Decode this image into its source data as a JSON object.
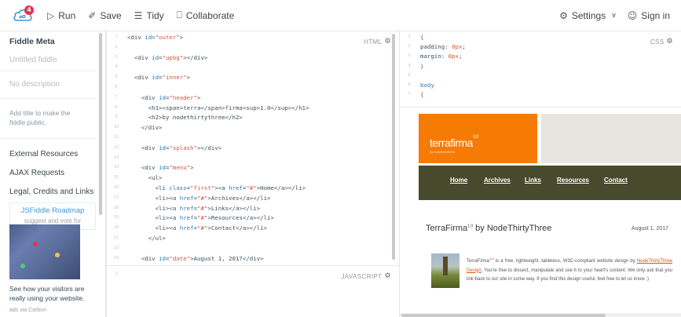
{
  "toolbar": {
    "logo_badge": "4",
    "run_label": "Run",
    "save_label": "Save",
    "tidy_label": "Tidy",
    "collaborate_label": "Collaborate",
    "settings_label": "Settings",
    "signin_label": "Sign in"
  },
  "sidebar": {
    "heading": "Fiddle Meta",
    "title_placeholder": "Untitled fiddle",
    "desc_placeholder": "No description",
    "help_text": "Add title to make the fiddle public.",
    "links": [
      "External Resources",
      "AJAX Requests",
      "Legal, Credits and Links"
    ],
    "roadmap_title": "JSFiddle Roadmap",
    "roadmap_sub": "suggest and vote for",
    "ad_text": "See how your visitors are really using your website.",
    "ad_via": "ads via Carbon"
  },
  "panels": {
    "html_label": "HTML",
    "js_label": "JAVASCRIPT",
    "css_label": "CSS"
  },
  "html_code": [
    {
      "n": "1",
      "html": "<span class='tag'>&lt;div </span><span class='an'>id</span>=<span class='av'>\"outer\"</span><span class='tag'>&gt;</span>"
    },
    {
      "n": "2",
      "html": ""
    },
    {
      "n": "3",
      "html": "  <span class='tag'>&lt;div </span><span class='an'>id</span>=<span class='av'>\"upbg\"</span><span class='tag'>&gt;&lt;/div&gt;</span>"
    },
    {
      "n": "4",
      "html": ""
    },
    {
      "n": "5",
      "html": "  <span class='tag'>&lt;div </span><span class='an'>id</span>=<span class='av'>\"inner\"</span><span class='tag'>&gt;</span>"
    },
    {
      "n": "6",
      "html": ""
    },
    {
      "n": "7",
      "html": "    <span class='tag'>&lt;div </span><span class='an'>id</span>=<span class='av'>\"header\"</span><span class='tag'>&gt;</span>"
    },
    {
      "n": "8",
      "html": "      <span class='tag'>&lt;h1&gt;&lt;span&gt;</span>terra<span class='tag'>&lt;/span&gt;</span>firma<span class='tag'>&lt;sup&gt;</span>1.0<span class='tag'>&lt;/sup&gt;&lt;/h1&gt;</span>"
    },
    {
      "n": "9",
      "html": "      <span class='tag'>&lt;h2&gt;</span>by nodethirtythree<span class='tag'>&lt;/h2&gt;</span>"
    },
    {
      "n": "10",
      "html": "    <span class='tag'>&lt;/div&gt;</span>"
    },
    {
      "n": "11",
      "html": ""
    },
    {
      "n": "12",
      "html": "    <span class='tag'>&lt;div </span><span class='an'>id</span>=<span class='av'>\"splash\"</span><span class='tag'>&gt;&lt;/div&gt;</span>"
    },
    {
      "n": "13",
      "html": ""
    },
    {
      "n": "14",
      "html": "    <span class='tag'>&lt;div </span><span class='an'>id</span>=<span class='av'>\"menu\"</span><span class='tag'>&gt;</span>"
    },
    {
      "n": "15",
      "html": "      <span class='tag'>&lt;ul&gt;</span>"
    },
    {
      "n": "16",
      "html": "        <span class='tag'>&lt;li </span><span class='an'>class</span>=<span class='av'>\"first\"</span><span class='tag'>&gt;&lt;a </span><span class='an'>href</span>=<span class='av'>\"#\"</span><span class='tag'>&gt;</span>Home<span class='tag'>&lt;/a&gt;&lt;/li&gt;</span>"
    },
    {
      "n": "17",
      "html": "        <span class='tag'>&lt;li&gt;&lt;a </span><span class='an'>href</span>=<span class='av'>\"#\"</span><span class='tag'>&gt;</span>Archives<span class='tag'>&lt;/a&gt;&lt;/li&gt;</span>"
    },
    {
      "n": "18",
      "html": "        <span class='tag'>&lt;li&gt;&lt;a </span><span class='an'>href</span>=<span class='av'>\"#\"</span><span class='tag'>&gt;</span>Links<span class='tag'>&lt;/a&gt;&lt;/li&gt;</span>"
    },
    {
      "n": "19",
      "html": "        <span class='tag'>&lt;li&gt;&lt;a </span><span class='an'>href</span>=<span class='av'>\"#\"</span><span class='tag'>&gt;</span>Resources<span class='tag'>&lt;/a&gt;&lt;/li&gt;</span>"
    },
    {
      "n": "20",
      "html": "        <span class='tag'>&lt;li&gt;&lt;a </span><span class='an'>href</span>=<span class='av'>\"#\"</span><span class='tag'>&gt;</span>Contact<span class='tag'>&lt;/a&gt;&lt;/li&gt;</span>"
    },
    {
      "n": "21",
      "html": "      <span class='tag'>&lt;/ul&gt;</span>"
    },
    {
      "n": "22",
      "html": ""
    },
    {
      "n": "23",
      "html": "    <span class='tag'>&lt;div </span><span class='an'>id</span>=<span class='av'>\"date\"</span><span class='tag'>&gt;</span>August 1, 2017<span class='tag'>&lt;/div&gt;</span>"
    }
  ],
  "css_code": [
    {
      "n": "1",
      "html": "<span class='brace'>{</span>"
    },
    {
      "n": "2",
      "html": "<span class='prop'>padding</span>: <span class='val'>0px</span>;"
    },
    {
      "n": "3",
      "html": "<span class='prop'>margin</span>: <span class='val'>0px</span>;"
    },
    {
      "n": "4",
      "html": "<span class='brace'>}</span>"
    },
    {
      "n": "5",
      "html": ""
    },
    {
      "n": "6",
      "html": "<span class='an'>body</span>"
    },
    {
      "n": "7",
      "html": "<span class='brace'>{</span>"
    }
  ],
  "js_code": [
    {
      "n": "1",
      "html": ""
    }
  ],
  "result": {
    "logo_main": "terrafirma",
    "logo_sup": "1.0",
    "logo_sub": "by nodethirtythree",
    "menu": [
      "Home",
      "Archives",
      "Links",
      "Resources",
      "Contact"
    ],
    "post_title": "TerraFirma",
    "post_title_sup": "1.0",
    "post_title_rest": " by NodeThirtyThree",
    "date": "August 1, 2017",
    "text_before": "TerraFirma",
    "text_sup": "1.0",
    "text_mid1": " is a free, lightweight, tableless, W3C-compliant website design by ",
    "text_link": "NodeThirtyThree Design",
    "text_mid2": ". You're free to dissect, manipulate and use it to your heart's content. We only ask that you link back to our site in some way. If you find this design useful, feel free to let us know :)"
  },
  "colors": {
    "accent_red": "#e9304f",
    "site_orange": "#f57b05",
    "site_menu": "#474a2c",
    "link_blue": "#3d9ad6"
  }
}
